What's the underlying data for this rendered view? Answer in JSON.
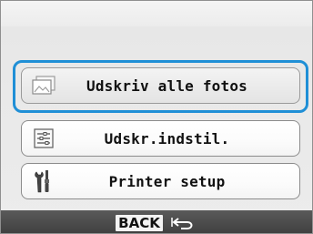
{
  "menu": {
    "items": [
      {
        "label": "Udskriv alle fotos",
        "icon": "photos-icon",
        "selected": true
      },
      {
        "label": "Udskr.indstil.",
        "icon": "print-settings-icon",
        "selected": false
      },
      {
        "label": "Printer setup",
        "icon": "tools-icon",
        "selected": false
      }
    ]
  },
  "footer": {
    "back_label": "BACK",
    "back_icon": "return-arrow-icon"
  },
  "colors": {
    "focus": "#1f8fd6",
    "footer_bg": "#4a4a4a"
  }
}
